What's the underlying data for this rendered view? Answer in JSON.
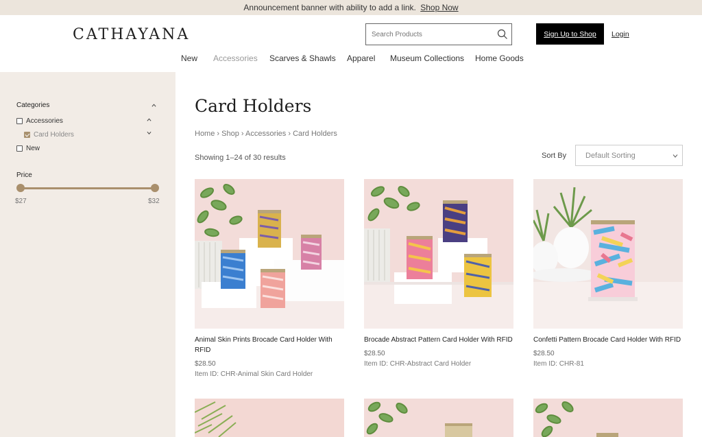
{
  "announcement": {
    "text": "Announcement banner with ability to add a link.",
    "link": "Shop Now"
  },
  "header": {
    "logo": "CATHAYANA",
    "search_placeholder": "Search Products",
    "signup_label": "Sign Up to Shop",
    "login_label": "Login"
  },
  "nav": [
    "New",
    "Accessories",
    "Scarves & Shawls",
    "Apparel",
    "Museum Collections",
    "Home Goods"
  ],
  "sidebar": {
    "categories_label": "Categories",
    "items": [
      {
        "label": "Accessories",
        "checked": false
      },
      {
        "label": "Card Holders",
        "checked": true
      },
      {
        "label": "New",
        "checked": false
      }
    ],
    "price_label": "Price",
    "price_min": "$27",
    "price_max": "$32"
  },
  "main": {
    "title": "Card Holders",
    "breadcrumb": [
      "Home",
      "Shop",
      "Accessories",
      "Card Holders"
    ],
    "results_text": "Showing 1–24 of 30 results",
    "sort_label": "Sort By",
    "sort_value": "Default Sorting"
  },
  "products": [
    {
      "name": "Animal Skin Prints Brocade Card Holder With RFID",
      "price": "$28.50",
      "item_id": "Item ID: CHR-Animal Skin Card Holder"
    },
    {
      "name": "Brocade Abstract Pattern Card Holder With RFID",
      "price": "$28.50",
      "item_id": "Item ID: CHR-Abstract Card Holder"
    },
    {
      "name": "Confetti Pattern Brocade Card Holder With RFID",
      "price": "$28.50",
      "item_id": "Item ID: CHR-81"
    }
  ],
  "colors": {
    "accent": "#a98f6c",
    "sidebar_bg": "#f2ece6",
    "banner_bg": "#ece5dc",
    "button_bg": "#000000"
  }
}
